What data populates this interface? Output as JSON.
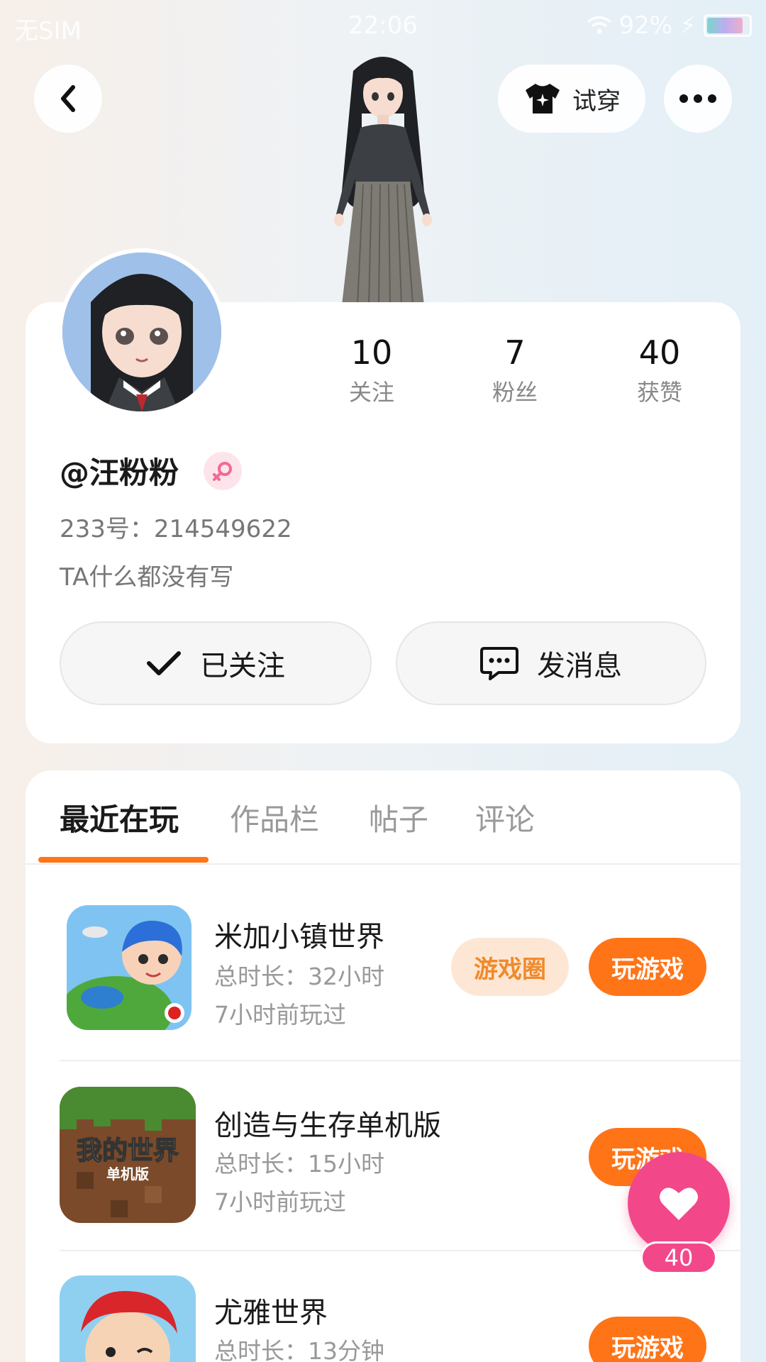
{
  "status_bar": {
    "carrier": "无SIM",
    "time": "22:06",
    "battery": "92%"
  },
  "header": {
    "try_on_label": "试穿"
  },
  "profile": {
    "stats": [
      {
        "value": "10",
        "label": "关注"
      },
      {
        "value": "7",
        "label": "粉丝"
      },
      {
        "value": "40",
        "label": "获赞"
      }
    ],
    "username": "@汪粉粉",
    "id_line": "233号：214549622",
    "bio": "TA什么都没有写",
    "follow_label": "已关注",
    "message_label": "发消息"
  },
  "tabs": [
    {
      "label": "最近在玩"
    },
    {
      "label": "作品栏"
    },
    {
      "label": "帖子"
    },
    {
      "label": "评论"
    }
  ],
  "games": [
    {
      "title": "米加小镇世界",
      "total": "总时长：32小时",
      "last": "7小时前玩过",
      "circle_label": "游戏圈",
      "play_label": "玩游戏"
    },
    {
      "title": "创造与生存单机版",
      "total": "总时长：15小时",
      "last": "7小时前玩过",
      "play_label": "玩游戏",
      "icon_text": "我的世界",
      "icon_sub": "单机版"
    },
    {
      "title": "尤雅世界",
      "total": "总时长：13分钟",
      "play_label": "玩游戏"
    }
  ],
  "like_fab": {
    "count": "40"
  },
  "colors": {
    "accent": "#ff7417",
    "accent_light": "#fde7d4",
    "like": "#f2488a"
  },
  "icons": [
    "back-icon",
    "tshirt-icon",
    "more-icon",
    "female-icon",
    "check-icon",
    "chat-icon",
    "heart-icon",
    "wifi-icon",
    "battery-icon"
  ]
}
